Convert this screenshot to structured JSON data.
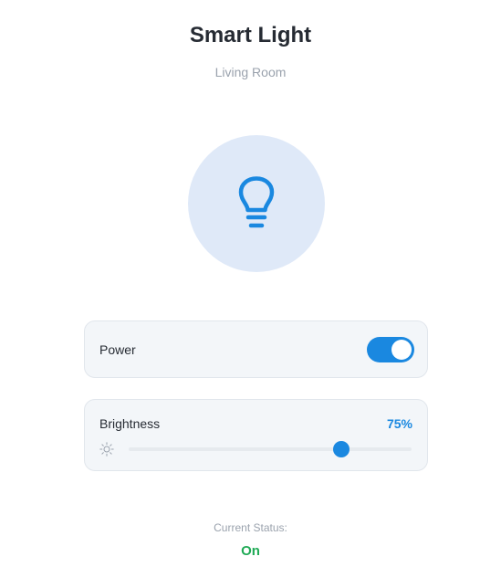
{
  "header": {
    "title": "Smart Light",
    "subtitle": "Living Room"
  },
  "bulb": {
    "icon": "lightbulb-icon",
    "color": "#1a88e0",
    "background": "#dfe9f8"
  },
  "power": {
    "label": "Power",
    "on": true,
    "toggle_color": "#1a88e0"
  },
  "brightness": {
    "label": "Brightness",
    "value_text": "75%",
    "value": 0.75,
    "icon": "sun-icon"
  },
  "status": {
    "label": "Current Status:",
    "value": "On",
    "color": "#1faa55"
  }
}
